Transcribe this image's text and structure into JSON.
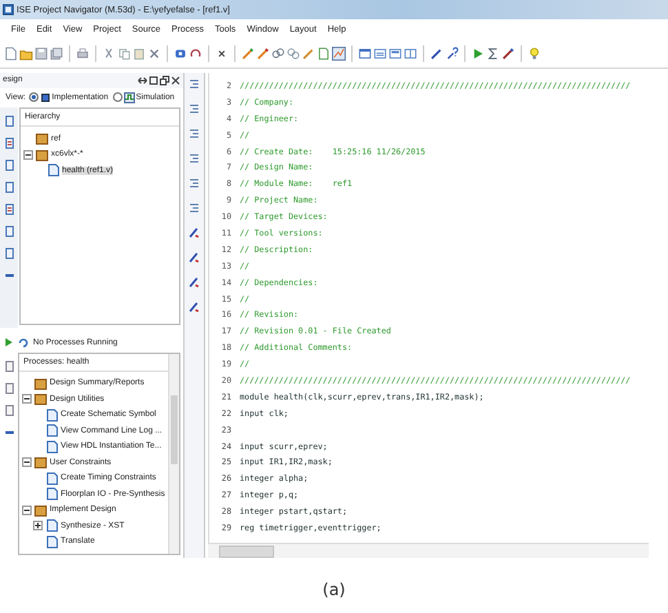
{
  "window": {
    "title": "ISE Project Navigator (M.53d) - E:\\yefyefalse - [ref1.v]"
  },
  "menu": [
    "File",
    "Edit",
    "View",
    "Project",
    "Source",
    "Process",
    "Tools",
    "Window",
    "Layout",
    "Help"
  ],
  "design_panel": {
    "title": "esign",
    "view_label": "View:",
    "view_options": [
      {
        "label": "Implementation",
        "selected": true
      },
      {
        "label": "Simulation",
        "selected": false
      }
    ],
    "hierarchy_title": "Hierarchy",
    "hierarchy": [
      {
        "label": "ref",
        "selected": false
      },
      {
        "label": "xc6vlx*-*",
        "selected": false,
        "expanded": true,
        "children": [
          {
            "label": "health (ref1.v)",
            "selected": true
          }
        ]
      }
    ],
    "process_status": "No Processes Running",
    "processes_title": "Processes: health",
    "processes": [
      {
        "label": "Design Summary/Reports"
      },
      {
        "label": "Design Utilities",
        "expanded": true,
        "children": [
          {
            "label": "Create Schematic Symbol"
          },
          {
            "label": "View Command Line Log ..."
          },
          {
            "label": "View HDL Instantiation Te..."
          }
        ]
      },
      {
        "label": "User Constraints",
        "expanded": true,
        "children": [
          {
            "label": "Create Timing Constraints"
          },
          {
            "label": "Floorplan IO - Pre-Synthesis"
          }
        ]
      },
      {
        "label": "Implement Design",
        "expanded": true,
        "children": [
          {
            "label": "Synthesize - XST",
            "expanded": false
          },
          {
            "label": "Translate"
          }
        ]
      }
    ]
  },
  "editor": {
    "lines": [
      {
        "number": "2",
        "kind": "comment",
        "text": "////////////////////////////////////////////////////////////////////////////////"
      },
      {
        "number": "3",
        "kind": "comment",
        "text": "// Company:"
      },
      {
        "number": "4",
        "kind": "comment",
        "text": "// Engineer:"
      },
      {
        "number": "5",
        "kind": "comment",
        "text": "//"
      },
      {
        "number": "6",
        "kind": "comment",
        "text": "// Create Date:    15:25:16 11/26/2015"
      },
      {
        "number": "7",
        "kind": "comment",
        "text": "// Design Name:"
      },
      {
        "number": "8",
        "kind": "comment",
        "text": "// Module Name:    ref1"
      },
      {
        "number": "9",
        "kind": "comment",
        "text": "// Project Name:"
      },
      {
        "number": "10",
        "kind": "comment",
        "text": "// Target Devices:"
      },
      {
        "number": "11",
        "kind": "comment",
        "text": "// Tool versions:"
      },
      {
        "number": "12",
        "kind": "comment",
        "text": "// Description:"
      },
      {
        "number": "13",
        "kind": "comment",
        "text": "//"
      },
      {
        "number": "14",
        "kind": "comment",
        "text": "// Dependencies:"
      },
      {
        "number": "15",
        "kind": "comment",
        "text": "//"
      },
      {
        "number": "16",
        "kind": "comment",
        "text": "// Revision:"
      },
      {
        "number": "17",
        "kind": "comment",
        "text": "// Revision 0.01 - File Created"
      },
      {
        "number": "18",
        "kind": "comment",
        "text": "// Additional Comments:"
      },
      {
        "number": "19",
        "kind": "comment",
        "text": "//"
      },
      {
        "number": "20",
        "kind": "comment",
        "text": "////////////////////////////////////////////////////////////////////////////////"
      },
      {
        "number": "21",
        "kind": "code",
        "text": "module health(clk,scurr,eprev,trans,IR1,IR2,mask);"
      },
      {
        "number": "22",
        "kind": "code",
        "text": "input clk;"
      },
      {
        "number": "23",
        "kind": "code"
      },
      {
        "number": "24",
        "kind": "code",
        "text": "input scurr,eprev;"
      },
      {
        "number": "25",
        "kind": "code",
        "text": "input IR1,IR2,mask;"
      },
      {
        "number": "26",
        "kind": "code",
        "text": "integer alpha;"
      },
      {
        "number": "27",
        "kind": "code",
        "text": "integer p,q;"
      },
      {
        "number": "28",
        "kind": "code",
        "text": "integer pstart,qstart;"
      },
      {
        "number": "29",
        "kind": "code",
        "text": "reg timetrigger,eventtrigger;"
      }
    ]
  },
  "caption": "(a)"
}
